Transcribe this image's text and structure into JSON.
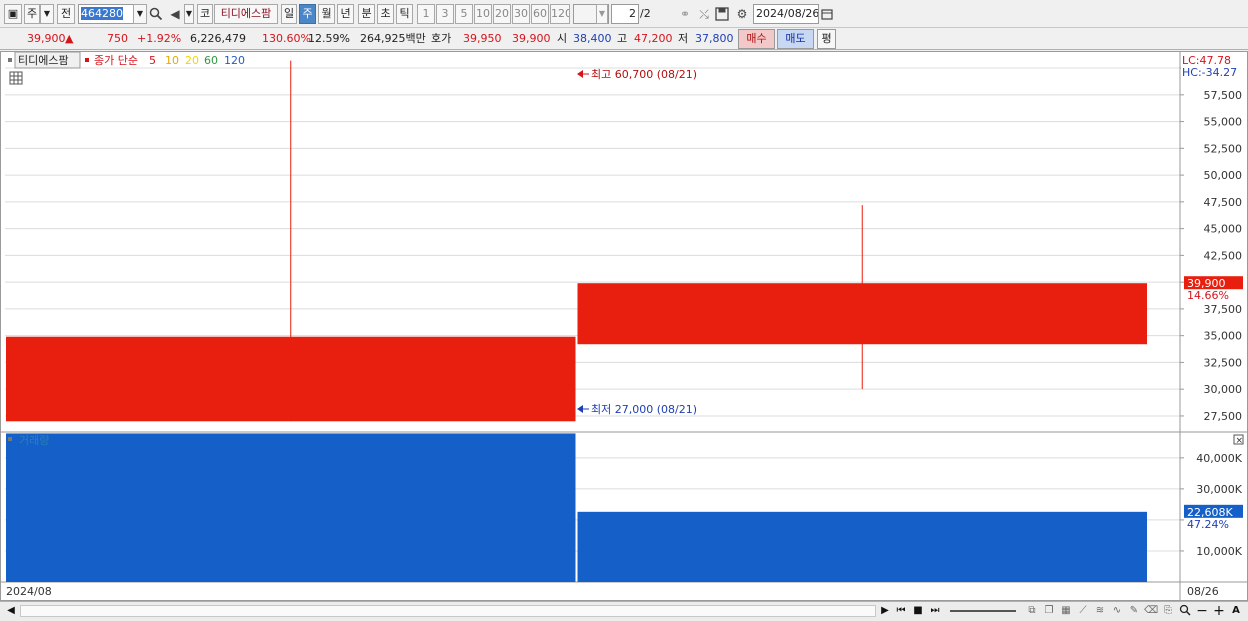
{
  "toolbar": {
    "period_type": "주",
    "prev_label": "전",
    "stock_code": "464280",
    "code_label": "코",
    "stock_name": "티디에스팜",
    "period_buttons": [
      "일",
      "주",
      "월",
      "년",
      "분",
      "초",
      "틱"
    ],
    "interval_buttons": [
      "1",
      "3",
      "5",
      "10",
      "20",
      "30",
      "60",
      "120"
    ],
    "page": "2",
    "page_total": "/2",
    "date": "2024/08/26"
  },
  "quote": {
    "price": "39,900",
    "change_arrow": "▲",
    "change": "750",
    "change_pct": "+1.92%",
    "volume": "6,226,479",
    "volume_ratio": "130.60%",
    "turnover": "12.59%",
    "amount": "264,925백만",
    "bid_label": "호가",
    "bid": "39,950",
    "ask": "39,900",
    "open_label": "시",
    "open": "38,400",
    "high_label": "고",
    "high": "47,200",
    "low_label": "저",
    "low": "37,800",
    "buy_label": "매수",
    "sell_label": "매도",
    "eval_label": "평"
  },
  "legend": {
    "name": "티디에스팜",
    "ma_label": "종가 단순",
    "ma_periods": [
      "5",
      "10",
      "20",
      "60",
      "120"
    ],
    "ma_colors": [
      "#d6141c",
      "#e8a800",
      "#f2d600",
      "#2e9a3e",
      "#2060c0"
    ],
    "volume_label": "거래량"
  },
  "annotations": {
    "high": "최고 60,700 (08/21)",
    "low": "최저 27,000 (08/21)",
    "lc": "LC:47.78",
    "hc": "HC:-34.27",
    "price_tag": "39,900",
    "price_pct": "14.66%",
    "vol_tag": "22,608K",
    "vol_pct": "47.24%"
  },
  "xaxis": {
    "start_label": "2024/08",
    "end_label": "08/26"
  },
  "colors": {
    "up": "#e81e0e",
    "volume": "#1560c8",
    "accent": "#4a86c8"
  },
  "chart_data": [
    {
      "type": "candlestick",
      "title": "",
      "ylim": [
        26000,
        61500
      ],
      "yticks": [
        27500,
        30000,
        32500,
        35000,
        37500,
        40000,
        42500,
        45000,
        47500,
        50000,
        52500,
        55000,
        57500,
        60000
      ],
      "ytick_labels": [
        "27,500",
        "30,000",
        "32,500",
        "35,000",
        "37,500",
        "40,000",
        "42,500",
        "45,000",
        "47,500",
        "50,000",
        "52,500",
        "55,000",
        "57,500",
        "60,000"
      ],
      "categories": [
        "08/21",
        "08/26"
      ],
      "open": [
        27000,
        34200
      ],
      "high": [
        60700,
        47200
      ],
      "low": [
        27000,
        30000
      ],
      "close": [
        34900,
        39900
      ]
    },
    {
      "type": "bar",
      "title": "",
      "ylim": [
        0,
        48000000
      ],
      "yticks": [
        10000000,
        20000000,
        30000000,
        40000000
      ],
      "ytick_labels": [
        "10,000K",
        "",
        "30,000K",
        "40,000K"
      ],
      "categories": [
        "08/21",
        "08/26"
      ],
      "values": [
        47860000,
        22608000
      ]
    }
  ]
}
